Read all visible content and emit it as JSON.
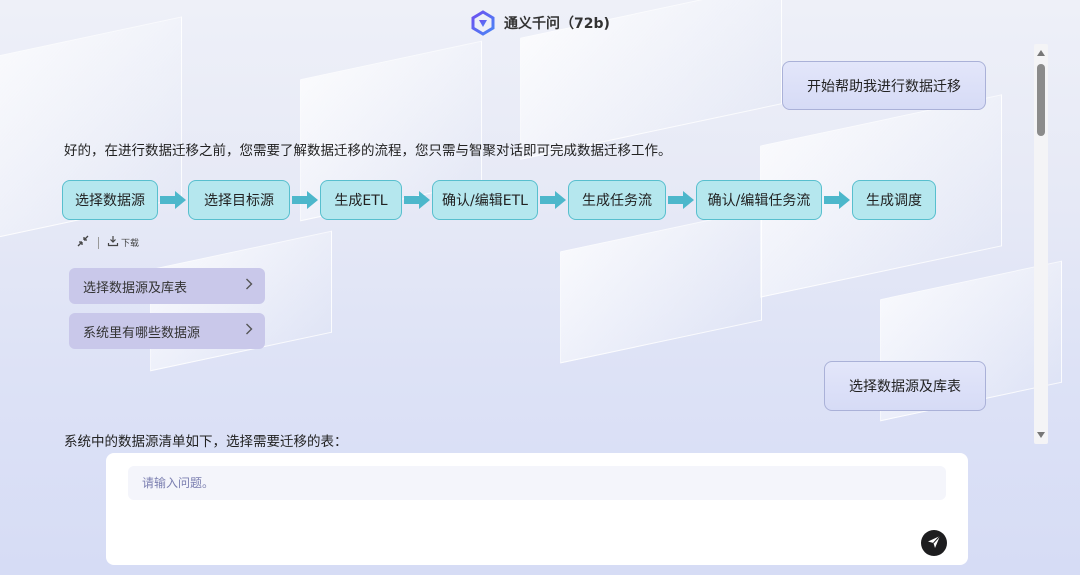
{
  "header": {
    "title": "通义千问（72b)",
    "logo_icon": "qwen-logo-icon"
  },
  "messages": [
    {
      "role": "user",
      "text": "开始帮助我进行数据迁移"
    },
    {
      "role": "assistant",
      "text": "好的，在进行数据迁移之前，您需要了解数据迁移的流程，您只需与智聚对话即可完成数据迁移工作。"
    },
    {
      "role": "user",
      "text": "选择数据源及库表"
    },
    {
      "role": "assistant",
      "text": "系统中的数据源清单如下，选择需要迁移的表："
    }
  ],
  "flow": {
    "steps": [
      "选择数据源",
      "选择目标源",
      "生成ETL",
      "确认/编辑ETL",
      "生成任务流",
      "确认/编辑任务流",
      "生成调度"
    ],
    "arrow_color": "#4db7cb",
    "step_color": "#b5e7ee"
  },
  "tools": {
    "collapse_icon": "collapse-arrows-icon",
    "download_icon": "download-icon",
    "download_label": "下载"
  },
  "suggestions": [
    "选择数据源及库表",
    "系统里有哪些数据源"
  ],
  "input": {
    "placeholder": "请输入问题。",
    "value": "",
    "send_icon": "send-paper-plane-icon"
  },
  "colors": {
    "user_bubble": "#d9ddf7",
    "suggestion_bg": "#c9c8ea",
    "accent": "#7a5cf0"
  }
}
